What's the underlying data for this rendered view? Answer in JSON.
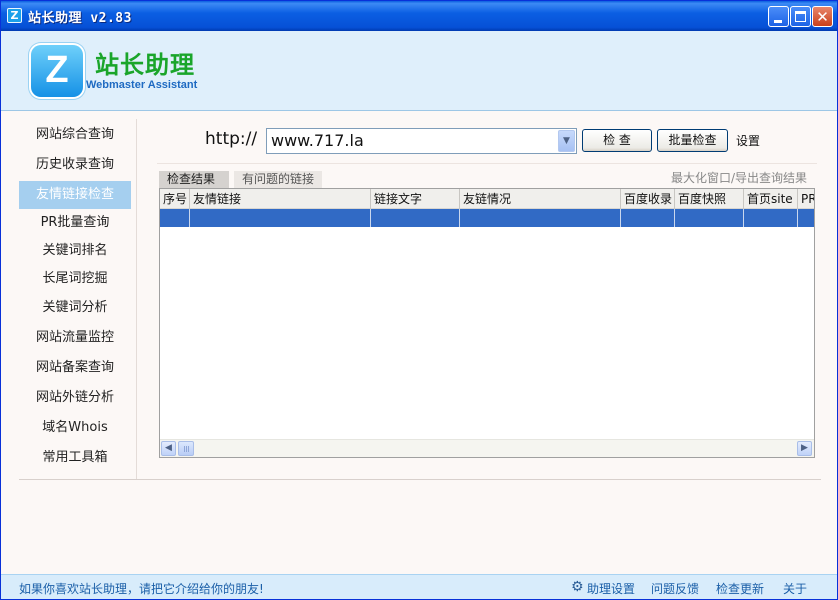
{
  "window": {
    "title": "站长助理 v2.83",
    "icon_letter": "Z"
  },
  "header": {
    "logo_letter": "Z",
    "brand_cn": "站长助理",
    "brand_en": "Webmaster Assistant"
  },
  "sidebar": {
    "items": [
      {
        "label": "网站综合查询",
        "active": false
      },
      {
        "label": "历史收录查询",
        "active": false
      },
      {
        "label": "友情链接检查",
        "active": true
      },
      {
        "label": "PR批量查询",
        "active": false
      },
      {
        "label": "关键词排名",
        "active": false
      },
      {
        "label": "长尾词挖掘",
        "active": false
      },
      {
        "label": "关键词分析",
        "active": false
      },
      {
        "label": "网站流量监控",
        "active": false
      },
      {
        "label": "网站备案查询",
        "active": false
      },
      {
        "label": "网站外链分析",
        "active": false
      },
      {
        "label": "域名Whois",
        "active": false
      },
      {
        "label": "常用工具箱",
        "active": false
      }
    ]
  },
  "search": {
    "prefix": "http://",
    "value": "www.717.la",
    "check_label": "检 查",
    "batch_label": "批量检查",
    "settings_label": "设置"
  },
  "tabs": {
    "results": "检查结果",
    "problems": "有问题的链接",
    "export": "最大化窗口/导出查询结果"
  },
  "grid": {
    "columns": [
      "序号",
      "友情链接",
      "链接文字",
      "友链情况",
      "百度收录",
      "百度快照",
      "首页site",
      "PR"
    ]
  },
  "status": {
    "message": "如果你喜欢站长助理，请把它介绍给你的朋友!",
    "settings": "助理设置",
    "feedback": "问题反馈",
    "update": "检查更新",
    "about": "关于"
  },
  "colors": {
    "accent": "#316ac5",
    "active_nav": "#a5cfef",
    "brand_green": "#1aa52a",
    "brand_blue": "#1e6ac2",
    "link": "#1b5fa8"
  },
  "icons": {
    "app": "app-logo-icon",
    "minimize": "minimize-icon",
    "maximize": "maximize-icon",
    "close": "close-icon",
    "dropdown": "chevron-down-icon",
    "settings": "gear-icon",
    "scroll_left": "arrow-left-icon",
    "scroll_right": "arrow-right-icon"
  }
}
